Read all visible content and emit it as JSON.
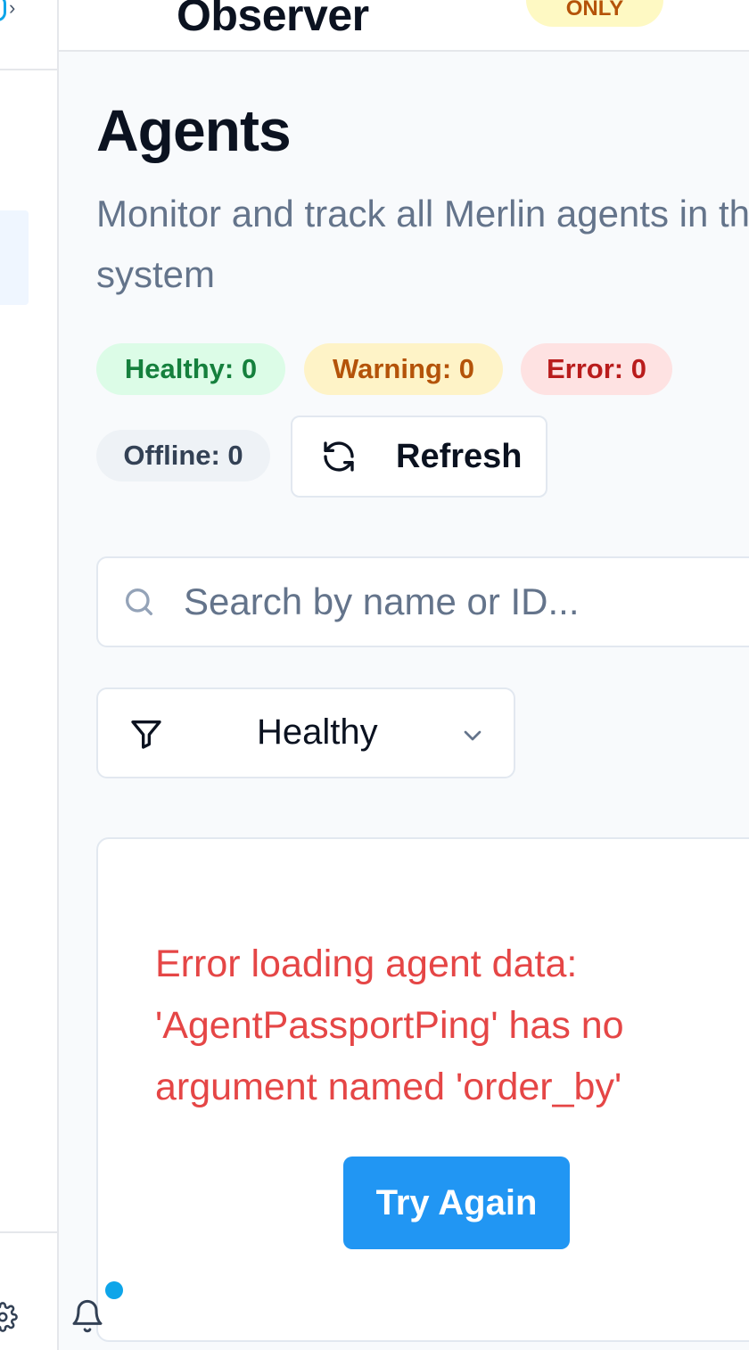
{
  "header": {
    "app_title": "Observer",
    "mode_badge": "ONLY"
  },
  "page": {
    "title": "Agents",
    "description": "Monitor and track all Merlin agents in the system"
  },
  "status_counts": {
    "healthy": "Healthy: 0",
    "warning": "Warning: 0",
    "error": "Error: 0",
    "offline": "Offline: 0"
  },
  "toolbar": {
    "refresh_label": "Refresh"
  },
  "search": {
    "placeholder": "Search by name or ID...",
    "value": ""
  },
  "filter": {
    "selected": "Healthy"
  },
  "error_state": {
    "message": "Error loading agent data: 'AgentPassportPing' has no argument named 'order_by'",
    "retry_label": "Try Again"
  },
  "icons": {
    "sidebar_settings": "gear-icon",
    "notifications": "bell-icon",
    "refresh": "refresh-icon",
    "search": "search-icon",
    "filter": "filter-icon",
    "dropdown": "chevron-down-icon"
  },
  "colors": {
    "primary_button": "#2196f3",
    "error_text": "#e54646",
    "healthy": "#15803d",
    "warning": "#b45309",
    "error": "#b91c1c",
    "notification_dot": "#0ea5e9"
  }
}
